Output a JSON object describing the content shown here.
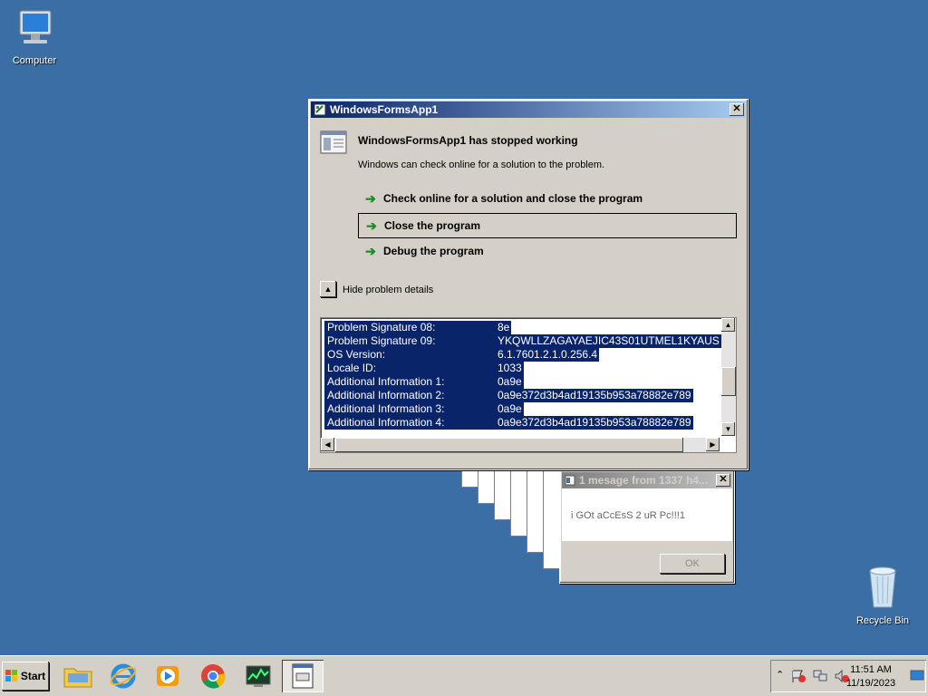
{
  "desktop": {
    "icons": [
      {
        "label": "Computer"
      },
      {
        "label": "Recycle Bin"
      }
    ]
  },
  "error_dialog": {
    "title": "WindowsFormsApp1",
    "headline": "WindowsFormsApp1 has stopped working",
    "subtext": "Windows can check online for a solution to the problem.",
    "options": [
      {
        "label": "Check online for a solution and close the program"
      },
      {
        "label": "Close the program"
      },
      {
        "label": "Debug the program"
      }
    ],
    "toggle_label": "Hide problem details",
    "details": [
      {
        "key": "Problem Signature 08:",
        "value": "8e"
      },
      {
        "key": "Problem Signature 09:",
        "value": "YKQWLLZAGAYAEJIC43S01UTMEL1KYAUS"
      },
      {
        "key": "OS Version:",
        "value": "6.1.7601.2.1.0.256.4"
      },
      {
        "key": "Locale ID:",
        "value": "1033"
      },
      {
        "key": "Additional Information 1:",
        "value": "0a9e"
      },
      {
        "key": "Additional Information 2:",
        "value": "0a9e372d3b4ad19135b953a78882e789"
      },
      {
        "key": "Additional Information 3:",
        "value": "0a9e"
      },
      {
        "key": "Additional Information 4:",
        "value": "0a9e372d3b4ad19135b953a78882e789"
      }
    ]
  },
  "message_box": {
    "title": "1 mesage from 1337 h4...",
    "text": "i GOt aCcEsS 2 uR Pc!!!1",
    "ok_label": "OK"
  },
  "taskbar": {
    "start_label": "Start",
    "clock_time": "11:51 AM",
    "clock_date": "11/19/2023"
  },
  "colors": {
    "desktop": "#3b6ea5",
    "title_active": "#0a246a",
    "selection": "#0a246a"
  }
}
